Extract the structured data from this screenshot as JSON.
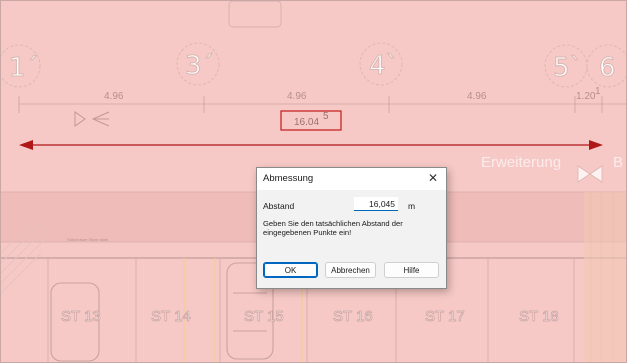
{
  "colors": {
    "background": "#f7c9c6",
    "measure_arrow": "#b01818",
    "dialog_bg": "#f2f2f2",
    "accent": "#0067c0"
  },
  "drawing": {
    "axis_labels": [
      "1´",
      "3´",
      "4`",
      "5`",
      "6"
    ],
    "dimensions": [
      "4.96",
      "4.96",
      "4.96",
      "1.20"
    ],
    "dimension_sup": "1",
    "measured_value": "16.04",
    "measured_sup": "5",
    "extension_label": "Erweiterung",
    "partial_label": "B",
    "small_note": "Stützmauer 50cm stark",
    "stalls": [
      "ST 13",
      "ST 14",
      "ST 15",
      "ST 16",
      "ST 17",
      "ST 18"
    ]
  },
  "dialog": {
    "title": "Abmessung",
    "close_icon": "close-icon",
    "field_label": "Abstand",
    "field_value": "16,045",
    "unit": "m",
    "instruction": "Geben Sie den tatsächlichen Abstand der eingegebenen Punkte ein!",
    "ok_label": "OK",
    "cancel_label": "Abbrechen",
    "help_label": "Hilfe"
  }
}
